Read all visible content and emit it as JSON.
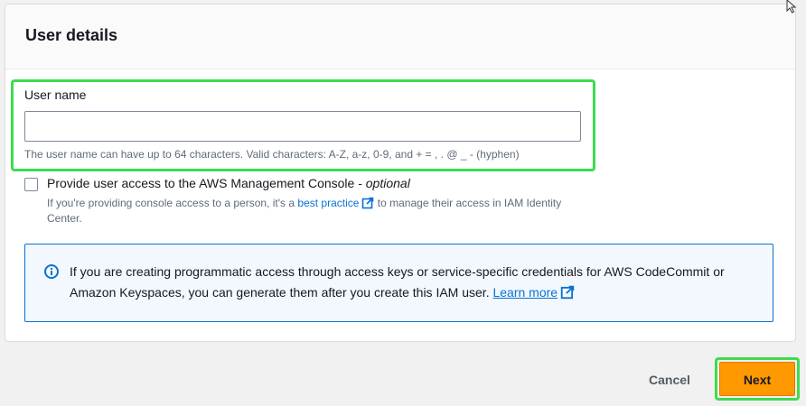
{
  "panel": {
    "title": "User details"
  },
  "username": {
    "label": "User name",
    "value": "",
    "placeholder": "",
    "constraint": "The user name can have up to 64 characters. Valid characters: A-Z, a-z, 0-9, and + = , . @ _ - (hyphen)"
  },
  "console_access": {
    "label": "Provide user access to the AWS Management Console - ",
    "optional": "optional",
    "checked": false,
    "desc_before": "If you're providing console access to a person, it's a ",
    "desc_link": "best practice",
    "desc_after": " to manage their access in IAM Identity Center."
  },
  "info_alert": {
    "text": "If you are creating programmatic access through access keys or service-specific credentials for AWS CodeCommit or Amazon Keyspaces, you can generate them after you create this IAM user. ",
    "link": "Learn more"
  },
  "actions": {
    "cancel": "Cancel",
    "next": "Next"
  },
  "icons": {
    "info": "info-icon",
    "external_link": "external-link-icon",
    "cursor": "mouse-cursor-icon"
  },
  "colors": {
    "highlight": "#3ddc4f",
    "primary_button": "#ff9900",
    "link": "#0972d3",
    "alert_bg": "#f2f8fd",
    "alert_border": "#0972d3"
  }
}
